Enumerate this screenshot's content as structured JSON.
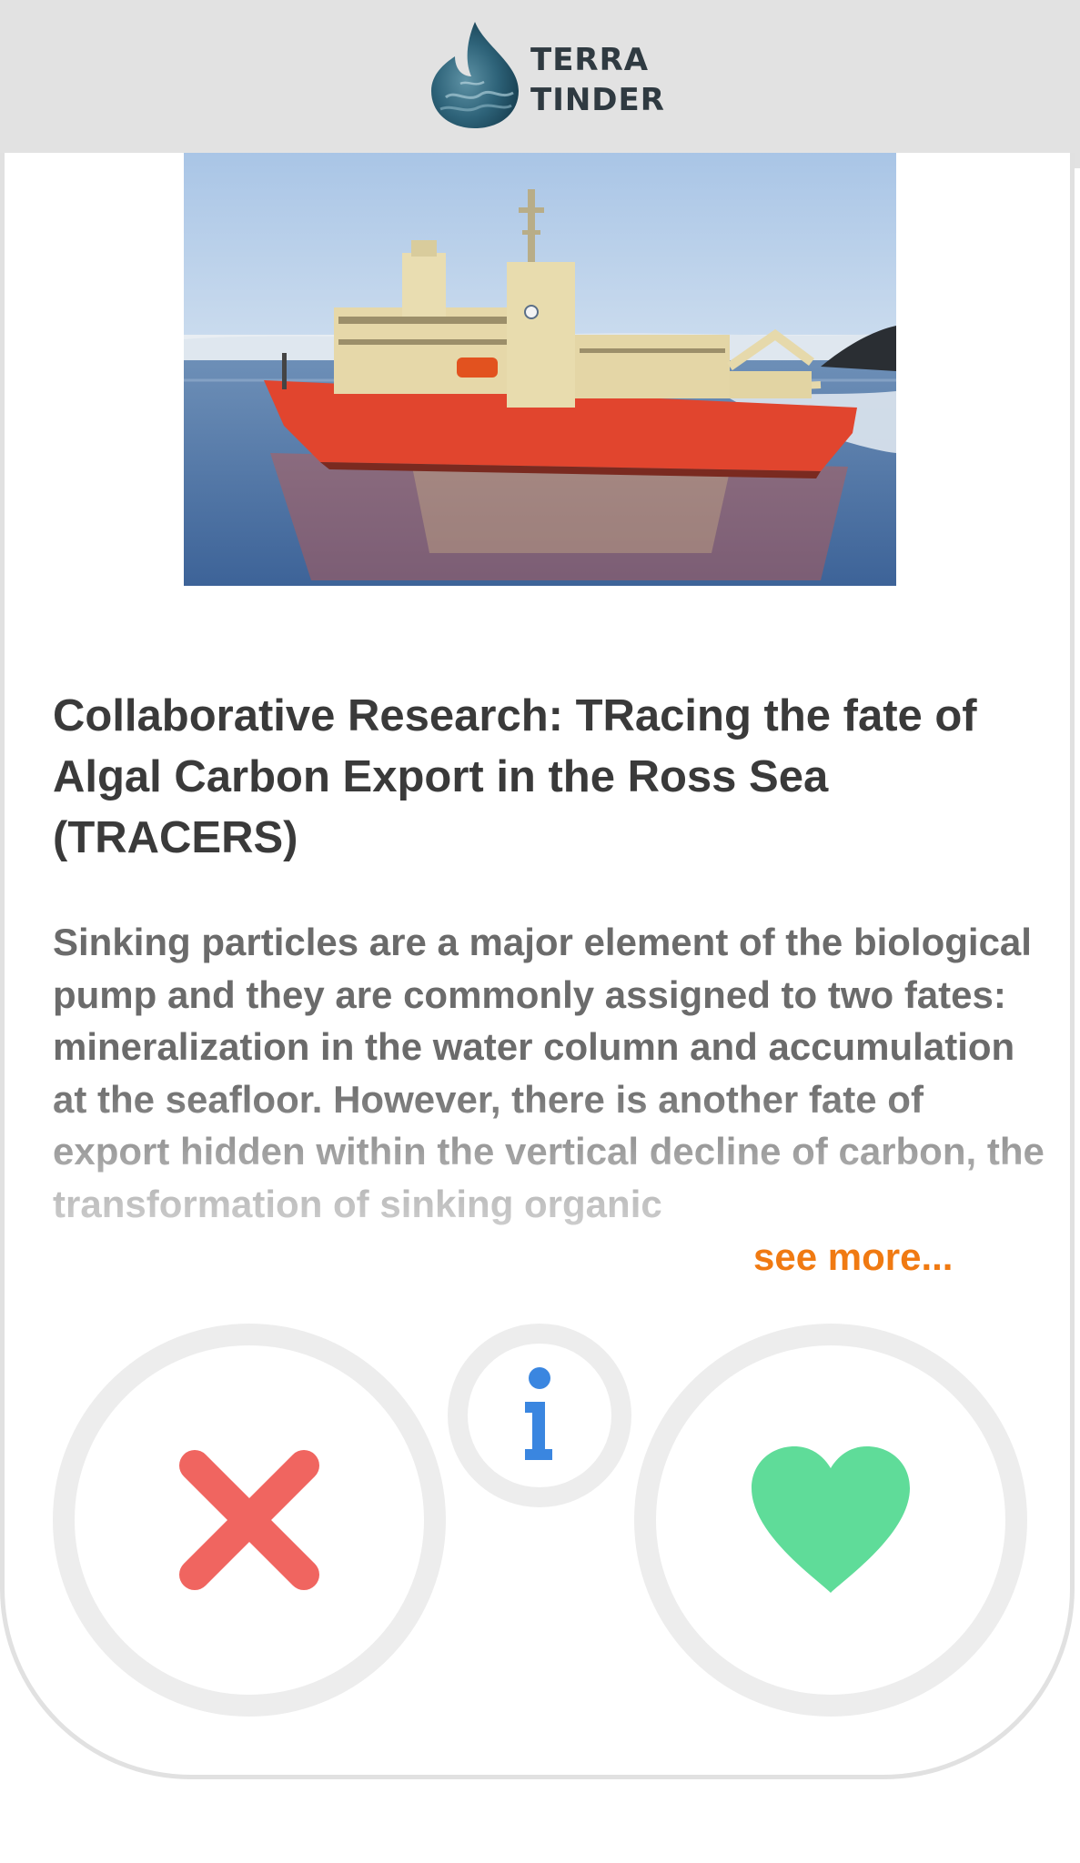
{
  "app": {
    "logo_line1": "TERRA",
    "logo_line2": "TINDER",
    "icon": "water-drop-logo"
  },
  "card": {
    "image_icon": "research-ship-photo",
    "title": "Collaborative Research: TRacing the fate of Algal Carbon Export in the Ross Sea (TRACERS)",
    "description": "Sinking particles are a major element of the biological pump and they are commonly assigned to two fates: mineralization in the water column and accumulation at the seafloor. However, there is another fate of export hidden within the vertical decline of carbon, the transformation of sinking organic",
    "see_more_label": "see more..."
  },
  "actions": {
    "reject_icon": "close-x-icon",
    "info_icon": "info-icon",
    "like_icon": "heart-icon"
  },
  "colors": {
    "header_bg": "#e2e2e2",
    "reject": "#f06560",
    "like": "#5fdc99",
    "info": "#3a86e0",
    "see_more": "#f07a12",
    "ring": "#ededed"
  }
}
